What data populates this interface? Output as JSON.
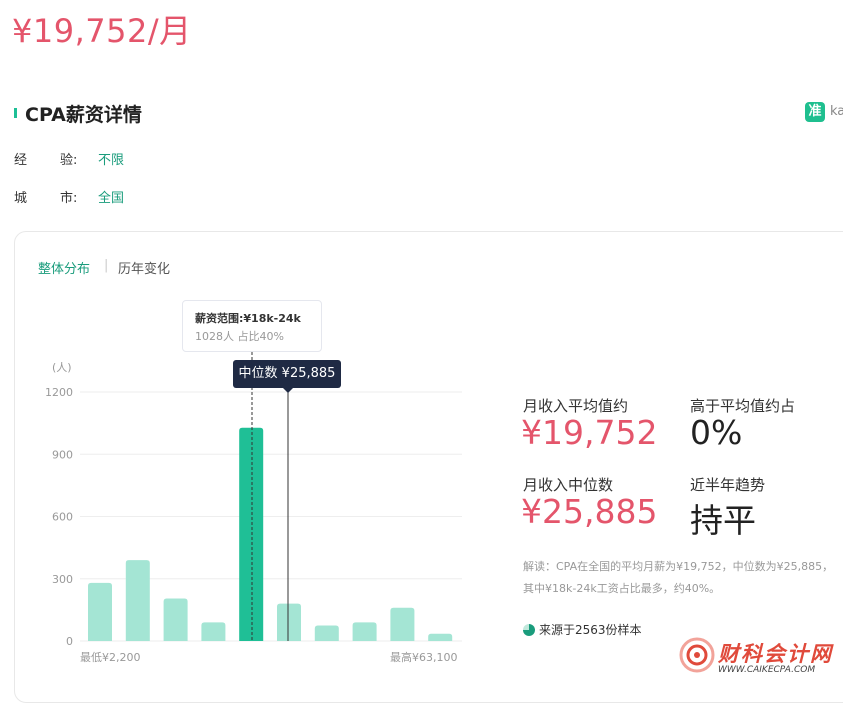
{
  "header": {
    "salary": "¥19,752/月"
  },
  "section": {
    "title": "CPA薪资详情",
    "brand_badge": "准",
    "brand_text": "ka"
  },
  "meta": [
    {
      "label_a": "经",
      "label_b": "验:",
      "value": "不限"
    },
    {
      "label_a": "城",
      "label_b": "市:",
      "value": "全国"
    }
  ],
  "tabs": {
    "active": "整体分布",
    "separator": "|",
    "other": "历年变化"
  },
  "tooltip": {
    "title": "薪资范围:¥18k-24k",
    "sub": "1028人  占比40%"
  },
  "median_tag": "中位数 ¥25,885",
  "chart_data": {
    "type": "bar",
    "unit_label": "(人)",
    "ylim": [
      0,
      1200
    ],
    "y_ticks": [
      1200,
      900,
      600,
      300,
      0
    ],
    "values": [
      280,
      390,
      205,
      90,
      1028,
      180,
      75,
      90,
      160,
      35
    ],
    "highlight_index": 4,
    "x_min_label": "最低¥2,200",
    "x_max_label": "最高¥63,100",
    "colors": {
      "bar": "#a4e5d4",
      "highlight": "#1fbf96",
      "grid": "#eeeeee"
    }
  },
  "stats": {
    "avg_label": "月收入平均值约",
    "avg_value": "¥19,752",
    "above_label": "高于平均值约占",
    "above_value": "0%",
    "median_label": "月收入中位数",
    "median_value": "¥25,885",
    "trend_label": "近半年趋势",
    "trend_value": "持平"
  },
  "note": {
    "line1": "解读：CPA在全国的平均月薪为¥19,752，中位数为¥25,885，",
    "line2": "其中¥18k-24k工资占比最多，约40%。"
  },
  "source": "来源于2563份样本",
  "watermark": {
    "title": "财科会计网",
    "sub": "WWW.CAIKECPA.COM"
  }
}
